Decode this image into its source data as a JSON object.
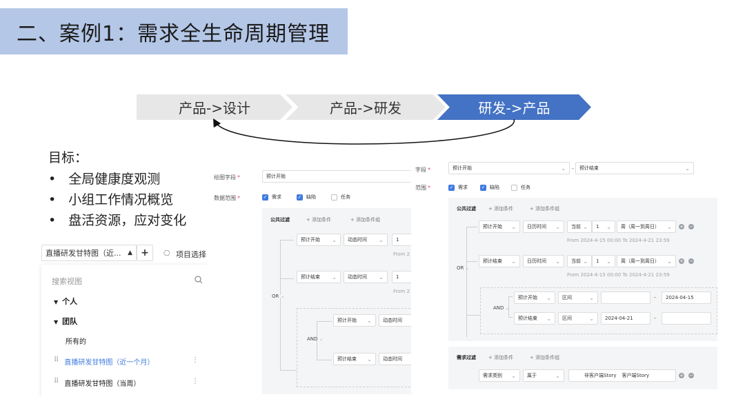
{
  "slide_title": "二、案例1：需求全生命周期管理",
  "steps": [
    "产品->设计",
    "产品->研发",
    "研发->产品"
  ],
  "accent": "#4472c4",
  "goals": {
    "title": "目标：",
    "items": [
      "全局健康度观测",
      "小组工作情况概览",
      "盘活资源，应对变化"
    ]
  },
  "view_panel": {
    "view_select": "直播研发甘特图（近...",
    "add_label": "+",
    "project_select": "项目选择",
    "search_placeholder": "搜索视图",
    "groups": [
      "个人",
      "团队"
    ],
    "all_label": "所有的",
    "items": [
      "直播研发甘特图（近一个月）",
      "直播研发甘特图（当周）"
    ]
  },
  "middle_panel": {
    "field_label": "绘图字段",
    "field_value": "预计开始",
    "range_label": "数据范围",
    "checks": [
      {
        "label": "需求",
        "checked": true
      },
      {
        "label": "缺陷",
        "checked": true
      },
      {
        "label": "任务",
        "checked": false
      }
    ],
    "public_filter": "公共过滤",
    "add_condition": "+ 添加条件",
    "add_group": "+ 添加条件组",
    "or_label": "OR",
    "and_label": "AND",
    "rows": [
      {
        "field": "预计开始",
        "op": "动态时间",
        "val": "1",
        "hint": "From 2"
      },
      {
        "field": "预计结束",
        "op": "动态时间",
        "val": "1",
        "hint": "From 2"
      }
    ],
    "nested_rows": [
      {
        "field": "预计开始",
        "op": "动态时间"
      },
      {
        "field": "预计结束",
        "op": "动态时间"
      }
    ]
  },
  "right_panel": {
    "field_label": "字段",
    "field_start": "预计开始",
    "sep": "-",
    "field_end": "预计结束",
    "range_label": "范围",
    "checks": [
      {
        "label": "需求",
        "checked": true
      },
      {
        "label": "缺陷",
        "checked": true
      },
      {
        "label": "任务",
        "checked": false
      }
    ],
    "public_filter": "公共过滤",
    "add_condition": "+ 添加条件",
    "add_group": "+ 添加条件组",
    "or_label": "OR",
    "and_label": "AND",
    "rows": [
      {
        "field": "预计开始",
        "type": "日历时间",
        "when": "当前",
        "num": "1",
        "unit": "周（周一到周日）",
        "hint": "From 2024-4-15 00:00 To 2024-4-21 23:59"
      },
      {
        "field": "预计结束",
        "type": "日历时间",
        "when": "当前",
        "num": "1",
        "unit": "周（周一到周日）",
        "hint": "From 2024-4-15 00:00 To 2024-4-21 23:59"
      }
    ],
    "nested_rows": [
      {
        "field": "预计开始",
        "op": "区间",
        "from": "",
        "to": "2024-04-15"
      },
      {
        "field": "预计结束",
        "op": "区间",
        "from": "2024-04-21",
        "to": ""
      }
    ],
    "req_filter": "需求过滤",
    "req_row": {
      "field": "需求类别",
      "op": "属于",
      "tags": [
        "非客户端Story",
        "客户端Story"
      ]
    }
  }
}
